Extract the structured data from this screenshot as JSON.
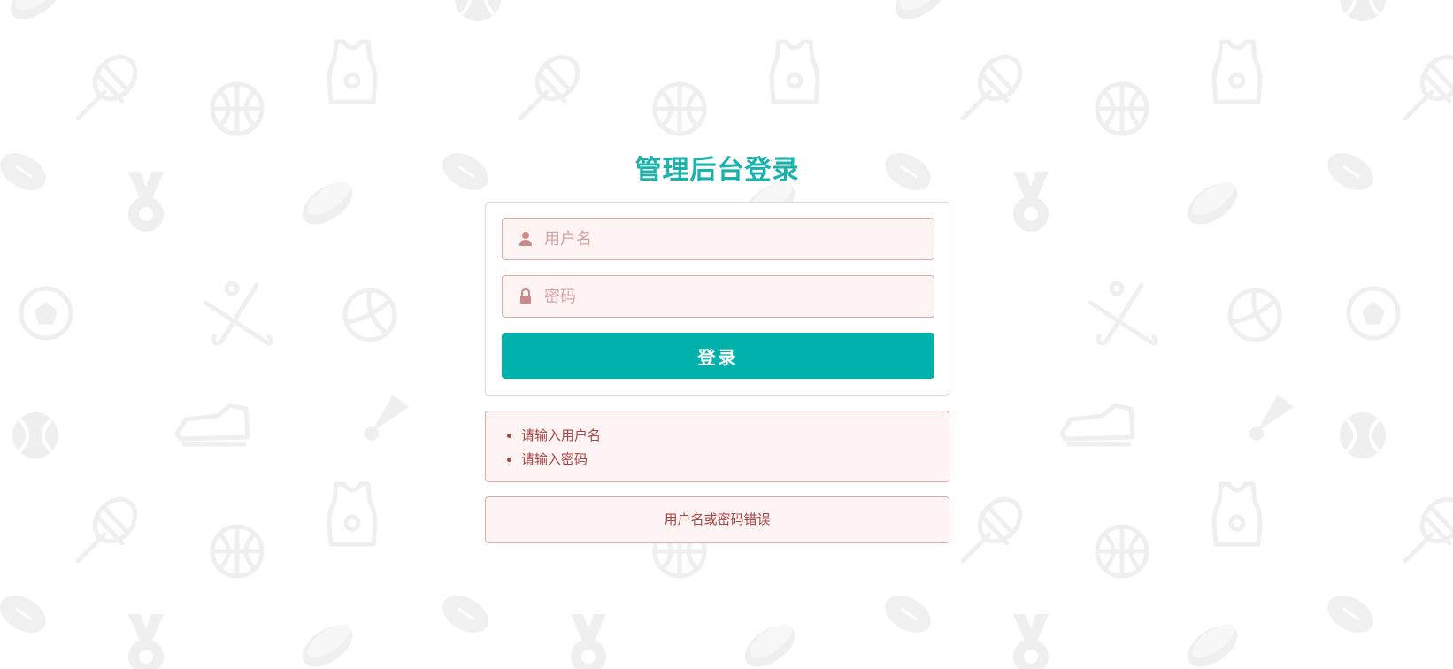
{
  "page": {
    "title": "管理后台登录"
  },
  "form": {
    "username_placeholder": "用户名",
    "password_placeholder": "密码",
    "username_value": "",
    "password_value": "",
    "submit_label": "登录"
  },
  "validation_errors": [
    {
      "text": "请输入用户名"
    },
    {
      "text": "请输入密码"
    }
  ],
  "login_error": "用户名或密码错误",
  "colors": {
    "accent": "#00b2ab",
    "title": "#1ab2ab",
    "error_text": "#a94442",
    "error_bg": "#fdf4f3",
    "error_border": "#dfa9a9",
    "background_icons": "#f2f2f2"
  },
  "icons": {
    "username": "user-icon",
    "password": "lock-icon",
    "background_pattern": [
      "tennis-racket-icon",
      "basketball-icon",
      "jersey-icon",
      "rugby-ball-icon",
      "medal-icon",
      "hockey-puck-icon",
      "soccer-ball-icon",
      "hockey-sticks-icon",
      "volleyball-icon",
      "tennis-ball-icon",
      "sneaker-icon",
      "shuttlecock-icon"
    ]
  }
}
